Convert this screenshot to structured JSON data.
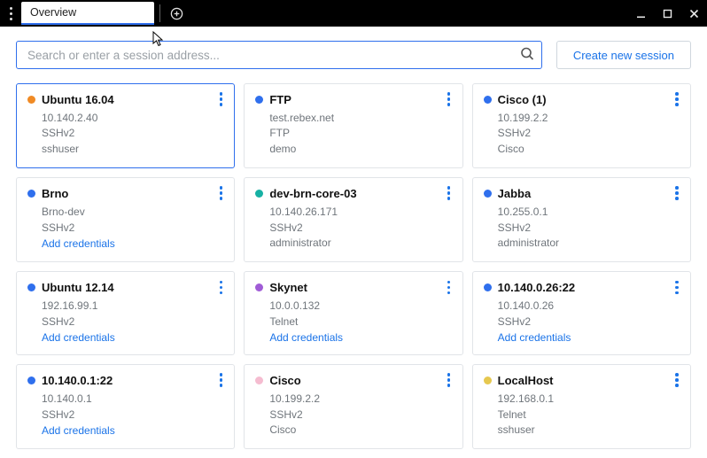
{
  "window": {
    "tab_title": "Overview"
  },
  "search": {
    "placeholder": "Search or enter a session address..."
  },
  "actions": {
    "create_session": "Create new session",
    "add_credentials": "Add credentials"
  },
  "colors": {
    "orange": "#f08a24",
    "blue": "#2f6fed",
    "teal": "#17b1a4",
    "purple": "#a05cd6",
    "pink": "#f5bcd0",
    "yellow": "#e6c84f"
  },
  "sessions": [
    {
      "name": "Ubuntu 16.04",
      "dot": "orange",
      "lines": [
        "10.140.2.40",
        "SSHv2",
        "sshuser"
      ],
      "selected": true
    },
    {
      "name": "FTP",
      "dot": "blue",
      "lines": [
        "test.rebex.net",
        "FTP",
        "demo"
      ]
    },
    {
      "name": "Cisco (1)",
      "dot": "blue",
      "lines": [
        "10.199.2.2",
        "SSHv2",
        "Cisco"
      ]
    },
    {
      "name": "Brno",
      "dot": "blue",
      "lines": [
        "Brno-dev",
        "SSHv2"
      ],
      "add_credentials": true
    },
    {
      "name": "dev-brn-core-03",
      "dot": "teal",
      "lines": [
        "10.140.26.171",
        "SSHv2",
        "administrator"
      ]
    },
    {
      "name": "Jabba",
      "dot": "blue",
      "lines": [
        "10.255.0.1",
        "SSHv2",
        "administrator"
      ]
    },
    {
      "name": "Ubuntu 12.14",
      "dot": "blue",
      "lines": [
        "192.16.99.1",
        "SSHv2"
      ],
      "add_credentials": true
    },
    {
      "name": "Skynet",
      "dot": "purple",
      "lines": [
        "10.0.0.132",
        "Telnet"
      ],
      "add_credentials": true
    },
    {
      "name": "10.140.0.26:22",
      "dot": "blue",
      "lines": [
        "10.140.0.26",
        "SSHv2"
      ],
      "add_credentials": true
    },
    {
      "name": "10.140.0.1:22",
      "dot": "blue",
      "lines": [
        "10.140.0.1",
        "SSHv2"
      ],
      "add_credentials": true
    },
    {
      "name": "Cisco",
      "dot": "pink",
      "lines": [
        "10.199.2.2",
        "SSHv2",
        "Cisco"
      ]
    },
    {
      "name": "LocalHost",
      "dot": "yellow",
      "lines": [
        "192.168.0.1",
        "Telnet",
        "sshuser"
      ]
    }
  ]
}
